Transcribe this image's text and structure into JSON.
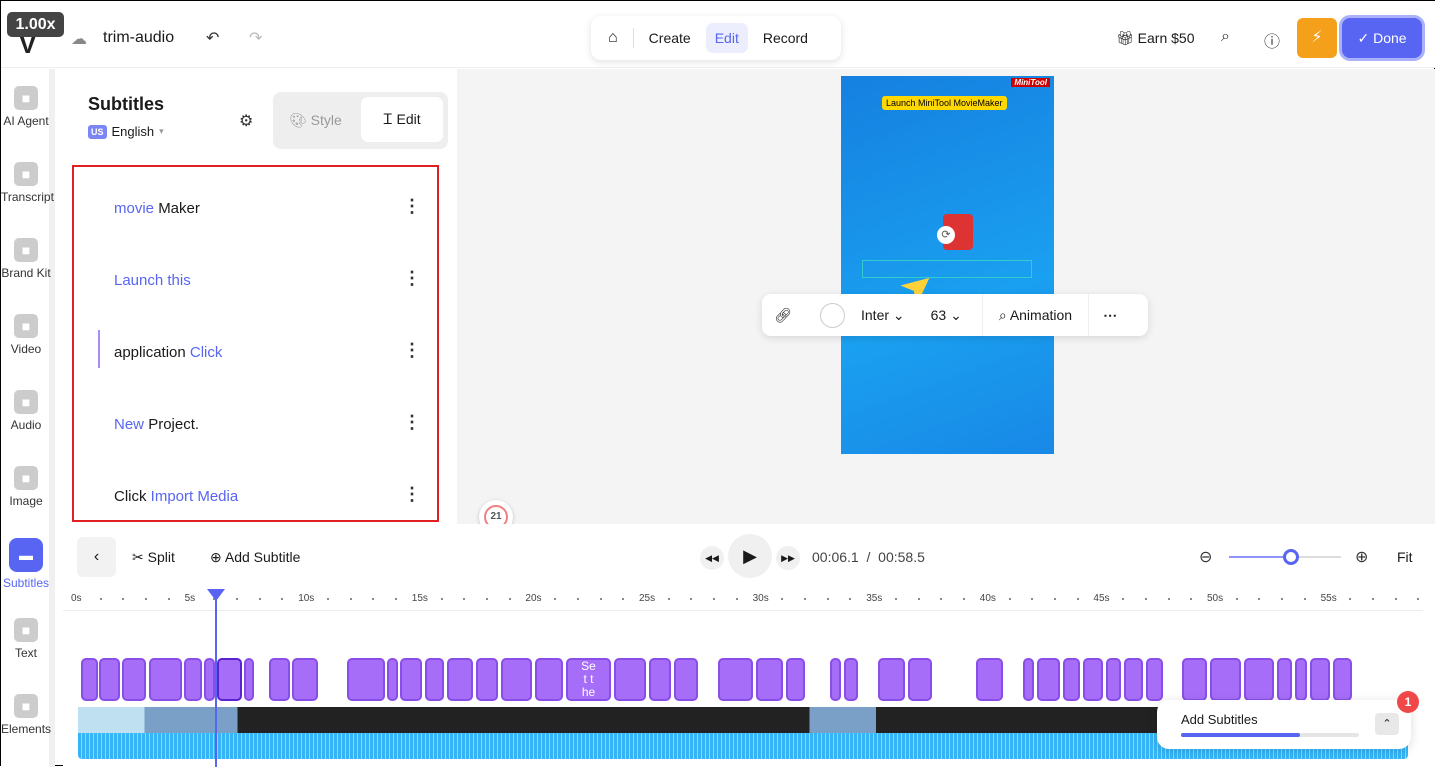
{
  "header": {
    "zoom_badge": "1.00x",
    "project_title": "trim-audio",
    "modes": [
      "Create",
      "Edit",
      "Record"
    ],
    "active_mode": "Edit",
    "earn": "Earn $50",
    "done": "Done"
  },
  "sidebar": {
    "items": [
      {
        "label": "AI Agent",
        "icon": "sparkle-icon"
      },
      {
        "label": "Transcript",
        "icon": "transcript-icon"
      },
      {
        "label": "Brand Kit",
        "icon": "brand-kit-icon"
      },
      {
        "label": "Video",
        "icon": "video-icon"
      },
      {
        "label": "Audio",
        "icon": "music-icon"
      },
      {
        "label": "Image",
        "icon": "image-icon"
      },
      {
        "label": "Subtitles",
        "icon": "subtitles-icon"
      },
      {
        "label": "Text",
        "icon": "text-icon"
      },
      {
        "label": "Elements",
        "icon": "elements-icon"
      }
    ]
  },
  "panel": {
    "title": "Subtitles",
    "lang_code": "US",
    "language": "English",
    "tab_style": "Style",
    "tab_edit": "Edit",
    "subtitles": [
      {
        "parts": [
          {
            "t": "movie ",
            "hl": true
          },
          {
            "t": "Maker",
            "hl": false
          }
        ]
      },
      {
        "parts": [
          {
            "t": "Launch this",
            "hl": true
          }
        ]
      },
      {
        "parts": [
          {
            "t": "application ",
            "hl": false
          },
          {
            "t": "Click",
            "hl": true
          }
        ]
      },
      {
        "parts": [
          {
            "t": "New ",
            "hl": true
          },
          {
            "t": "Project.",
            "hl": false
          }
        ]
      },
      {
        "parts": [
          {
            "t": "Click ",
            "hl": false
          },
          {
            "t": "Import Media",
            "hl": true
          }
        ]
      }
    ]
  },
  "preview": {
    "logo": "MiniTool",
    "caption": "Launch MiniTool MovieMaker",
    "font": "Inter",
    "font_size": "63",
    "animation": "Animation",
    "badge_count": "21"
  },
  "timeline": {
    "split": "Split",
    "add_subtitle": "Add Subtitle",
    "current": "00:06.1",
    "separator": "/",
    "total": "00:58.5",
    "fit": "Fit",
    "zoom_level": 0.55,
    "ticks": [
      "0s",
      "5s",
      "10s",
      "15s",
      "20s",
      "25s",
      "30s",
      "35s",
      "40s",
      "45s",
      "50s",
      "55s"
    ],
    "clip_text": "Se t t he"
  },
  "toast": {
    "label": "Add Subtitles",
    "count": "1",
    "progress": 0.67
  }
}
